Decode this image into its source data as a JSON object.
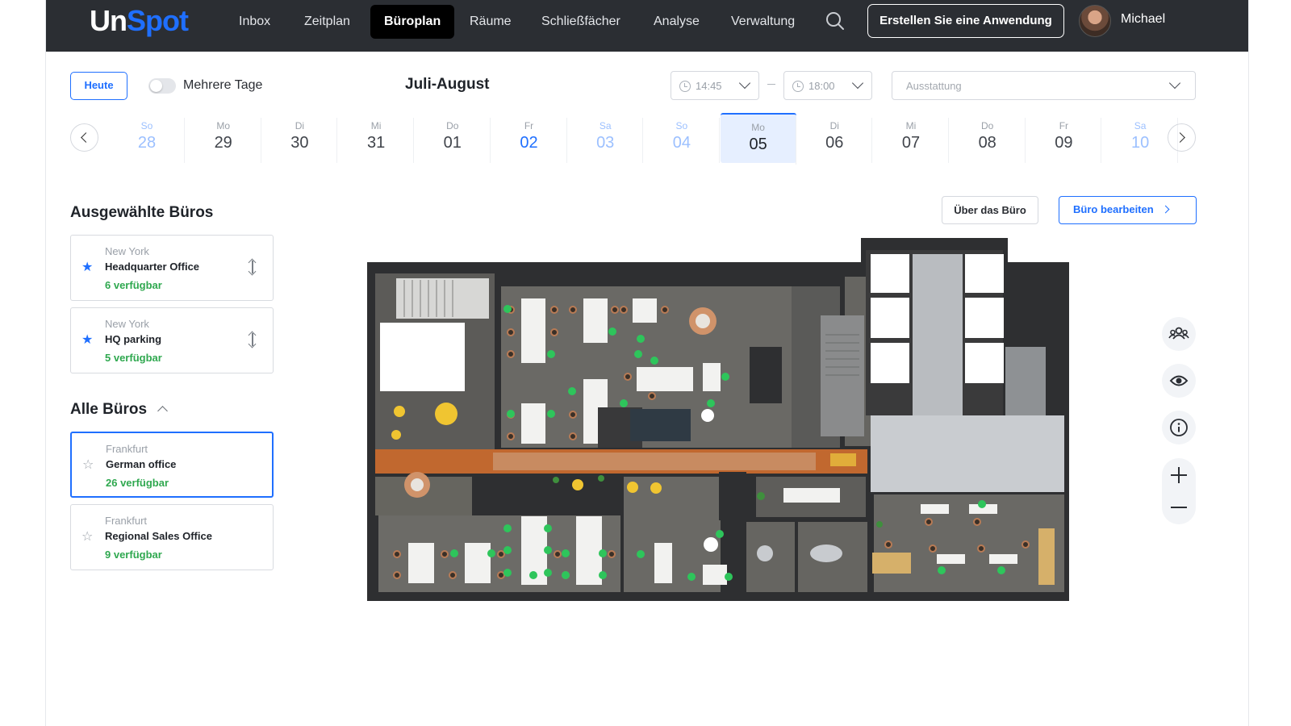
{
  "brand": {
    "part1": "Un",
    "part2": "Spot"
  },
  "nav": {
    "items": [
      {
        "label": "Inbox"
      },
      {
        "label": "Zeitplan"
      },
      {
        "label": "Büroplan",
        "active": true
      },
      {
        "label": "Räume"
      },
      {
        "label": "Schließfächer"
      },
      {
        "label": "Analyse"
      },
      {
        "label": "Verwaltung"
      }
    ],
    "search_icon": "search-icon",
    "create_button": "Erstellen Sie eine Anwendung",
    "user_name": "Michael"
  },
  "toolbar": {
    "today_button": "Heute",
    "multi_day_toggle": {
      "label": "Mehrere Tage",
      "on": false
    },
    "month_label": "Juli-August",
    "time_from": "14:45",
    "time_to": "18:00",
    "equipment_placeholder": "Ausstattung"
  },
  "date_strip": [
    {
      "dow": "So",
      "day": "28",
      "style": "weekend"
    },
    {
      "dow": "Mo",
      "day": "29",
      "style": "normal"
    },
    {
      "dow": "Di",
      "day": "30",
      "style": "normal"
    },
    {
      "dow": "Mi",
      "day": "31",
      "style": "normal"
    },
    {
      "dow": "Do",
      "day": "01",
      "style": "normal"
    },
    {
      "dow": "Fr",
      "day": "02",
      "style": "blue"
    },
    {
      "dow": "Sa",
      "day": "03",
      "style": "weekend"
    },
    {
      "dow": "So",
      "day": "04",
      "style": "weekend"
    },
    {
      "dow": "Mo",
      "day": "05",
      "style": "selected"
    },
    {
      "dow": "Di",
      "day": "06",
      "style": "normal"
    },
    {
      "dow": "Mi",
      "day": "07",
      "style": "normal"
    },
    {
      "dow": "Do",
      "day": "08",
      "style": "normal"
    },
    {
      "dow": "Fr",
      "day": "09",
      "style": "normal"
    },
    {
      "dow": "Sa",
      "day": "10",
      "style": "weekend"
    }
  ],
  "selected_offices": {
    "title": "Ausgewählte Büros",
    "items": [
      {
        "city": "New York",
        "name": "Headquarter Office",
        "available": "6 verfügbar",
        "starred": true
      },
      {
        "city": "New York",
        "name": "HQ parking",
        "available": "5 verfügbar",
        "starred": true
      }
    ]
  },
  "all_offices": {
    "title": "Alle Büros",
    "items": [
      {
        "city": "Frankfurt",
        "name": "German office",
        "available": "26 verfügbar",
        "starred": false,
        "active": true
      },
      {
        "city": "Frankfurt",
        "name": "Regional Sales Office",
        "available": "9 verfügbar",
        "starred": false
      }
    ]
  },
  "office_header": {
    "about_button": "Über das Büro",
    "edit_button": "Büro bearbeiten"
  },
  "map_controls": [
    "people-icon",
    "eye-icon",
    "info-icon",
    "zoom-in-icon",
    "zoom-out-icon"
  ],
  "colors": {
    "accent": "#1f6fff",
    "topbar": "#2b2e33",
    "available": "#2fa84f"
  }
}
